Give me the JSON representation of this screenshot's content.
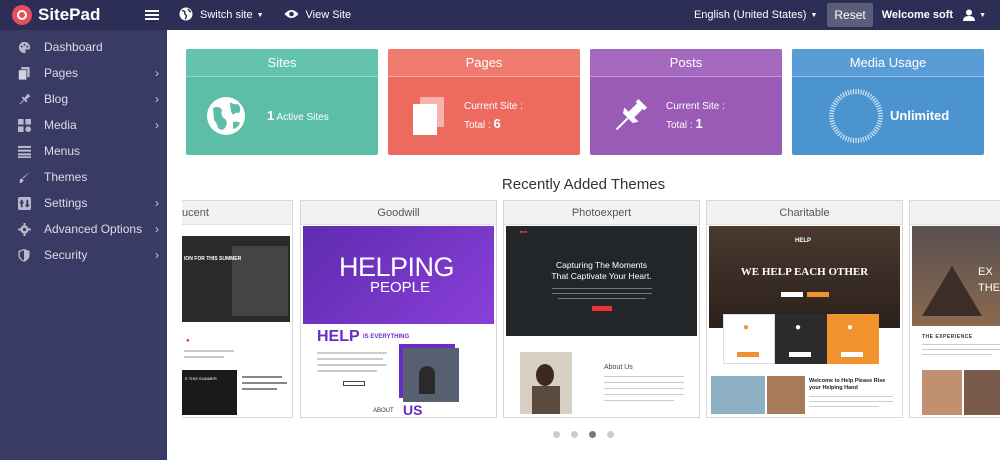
{
  "header": {
    "brand": "SitePad",
    "switch_site": "Switch site",
    "view_site": "View Site",
    "language": "English (United States)",
    "reset": "Reset",
    "welcome": "Welcome soft"
  },
  "sidebar": {
    "items": [
      {
        "label": "Dashboard",
        "icon": "palette-icon",
        "arrow": false
      },
      {
        "label": "Pages",
        "icon": "pages-icon",
        "arrow": true
      },
      {
        "label": "Blog",
        "icon": "pin-icon",
        "arrow": true
      },
      {
        "label": "Media",
        "icon": "media-icon",
        "arrow": true
      },
      {
        "label": "Menus",
        "icon": "menu-list-icon",
        "arrow": false
      },
      {
        "label": "Themes",
        "icon": "brush-icon",
        "arrow": false
      },
      {
        "label": "Settings",
        "icon": "settings-icon",
        "arrow": true
      },
      {
        "label": "Advanced Options",
        "icon": "gear-icon",
        "arrow": true
      },
      {
        "label": "Security",
        "icon": "shield-icon",
        "arrow": true
      }
    ]
  },
  "cards": {
    "sites": {
      "title": "Sites",
      "count": "1",
      "text": "Active Sites"
    },
    "pages": {
      "title": "Pages",
      "line1": "Current Site :",
      "total_label": "Total :",
      "total": "6"
    },
    "posts": {
      "title": "Posts",
      "line1": "Current Site :",
      "total_label": "Total :",
      "total": "1"
    },
    "media": {
      "title": "Media Usage",
      "text": "Unlimited"
    }
  },
  "themes_section": {
    "title": "Recently Added Themes",
    "themes": [
      {
        "name": "ucent",
        "hero": "ION FOR THIS SUMMER",
        "sub": "E THIS SUMMER"
      },
      {
        "name": "Goodwill",
        "hero": "HELPING",
        "hero2": "PEOPLE",
        "help": "HELP",
        "help_sub": "IS EVERYTHING",
        "about": "ABOUT",
        "us": "US"
      },
      {
        "name": "Photoexpert",
        "hero": "Capturing The Moments",
        "hero2": "That Captivate Your Heart.",
        "about": "About Us"
      },
      {
        "name": "Charitable",
        "hero": "WE HELP EACH OTHER",
        "welcome": "Welcome to Help Please Rise your Helping Hand"
      },
      {
        "name": "",
        "hero": "EX",
        "hero2": "THE",
        "exp": "THE EXPERIENCE"
      }
    ],
    "dots": 4,
    "active_dot": 2
  },
  "colors": {
    "topbar": "#2c2e56",
    "sidebar": "#393b64",
    "sites": "#5cbea6",
    "pages": "#ec6a5e",
    "posts": "#9a5bb6",
    "media": "#4c94d0"
  }
}
